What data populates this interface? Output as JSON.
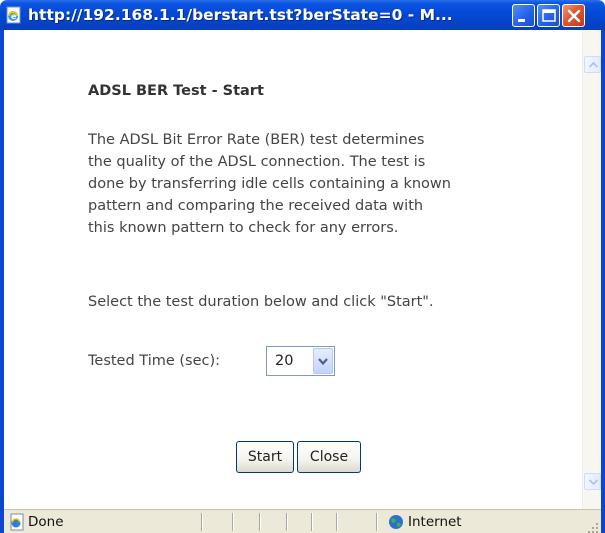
{
  "window": {
    "title": "http://192.168.1.1/berstart.tst?berState=0 - M..."
  },
  "page": {
    "heading": "ADSL BER Test - Start",
    "description_lines": [
      "The ADSL Bit Error Rate (BER) test determines",
      "the quality of the ADSL connection. The test is",
      "done by transferring idle cells containing a known",
      "pattern and comparing the received data with",
      "this known pattern to check for any errors."
    ],
    "instruction": "Select the test duration below and click \"Start\".",
    "tested_time": {
      "label": "Tested Time (sec):",
      "value": "20"
    },
    "buttons": {
      "start": "Start",
      "close": "Close"
    }
  },
  "statusbar": {
    "status": "Done",
    "zone": "Internet"
  },
  "icons": {
    "title": "ie-page-icon",
    "minimize": "minimize-icon",
    "maximize": "maximize-icon",
    "close": "close-icon",
    "dropdown": "chevron-down-icon",
    "status": "ie-page-icon",
    "zone": "globe-icon"
  },
  "colors": {
    "titlebar": "#0449d6",
    "close_button": "#e0562e",
    "statusbar": "#ece9d8",
    "text": "#444444"
  }
}
